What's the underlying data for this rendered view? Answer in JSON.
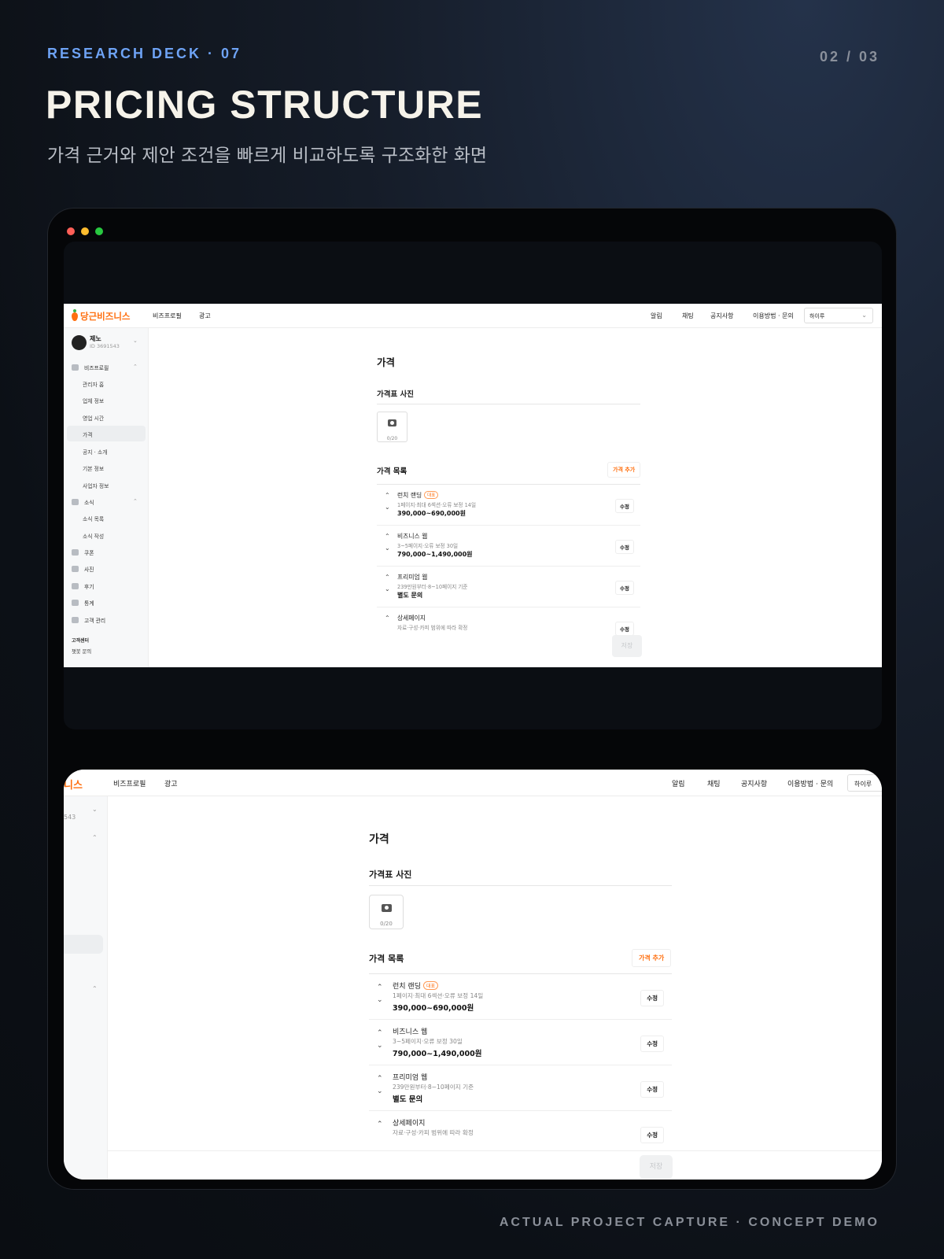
{
  "header": {
    "eyebrow": "RESEARCH DECK · 07",
    "counter": "02 / 03",
    "title": "PRICING STRUCTURE",
    "subtitle": "가격 근거와 제안 조건을 빠르게 비교하도록 구조화한 화면"
  },
  "footer": {
    "caption": "ACTUAL PROJECT CAPTURE · CONCEPT DEMO"
  },
  "colors": {
    "accent": "#6ea3f5",
    "brand": "#ff6f0f",
    "dot_red": "#ff5f57",
    "dot_yellow": "#febc2e",
    "dot_green": "#28c840"
  },
  "app": {
    "logo": "당근비즈니스",
    "logo_fragment": "니스",
    "nav": [
      "비즈프로필",
      "광고"
    ],
    "top_links": [
      "알림",
      "채팅",
      "공지사항",
      "이용방법 · 문의"
    ],
    "account_select": "하이루",
    "user": {
      "name": "제노",
      "id": "ID 3691543",
      "id_fragment": "543"
    },
    "sidebar": {
      "profile_section": "비즈프로필",
      "profile_items": [
        "관리자 홈",
        "업체 정보",
        "영업 시간",
        "가격",
        "공지 · 소개",
        "기본 정보",
        "사업자 정보"
      ],
      "news_section": "소식",
      "news_items": [
        "소식 목록",
        "소식 작성"
      ],
      "other_sections": [
        "쿠폰",
        "사진",
        "후기",
        "통계",
        "고객 관리"
      ],
      "support_title": "고객센터",
      "support_link": "챗봇 문의"
    },
    "main": {
      "page_title": "가격",
      "photo_section": "가격표 사진",
      "photo_count": "0/20",
      "list_section": "가격 목록",
      "add_button": "가격 추가",
      "edit_label": "수정",
      "save_label": "저장",
      "badge": "대표",
      "items": [
        {
          "name": "런치 랜딩",
          "desc": "1페이지·최대 6섹션·오류 보정 14일",
          "price": "390,000~690,000원"
        },
        {
          "name": "비즈니스 웹",
          "desc": "3~5페이지·오류 보정 30일",
          "price": "790,000~1,490,000원"
        },
        {
          "name": "프리미엄 웹",
          "desc": "239만원부터·8~10페이지 기준",
          "price": "별도 문의"
        },
        {
          "name": "상세페이지",
          "desc": "자료·구성·카피 범위에 따라 확정",
          "price": ""
        }
      ]
    }
  }
}
